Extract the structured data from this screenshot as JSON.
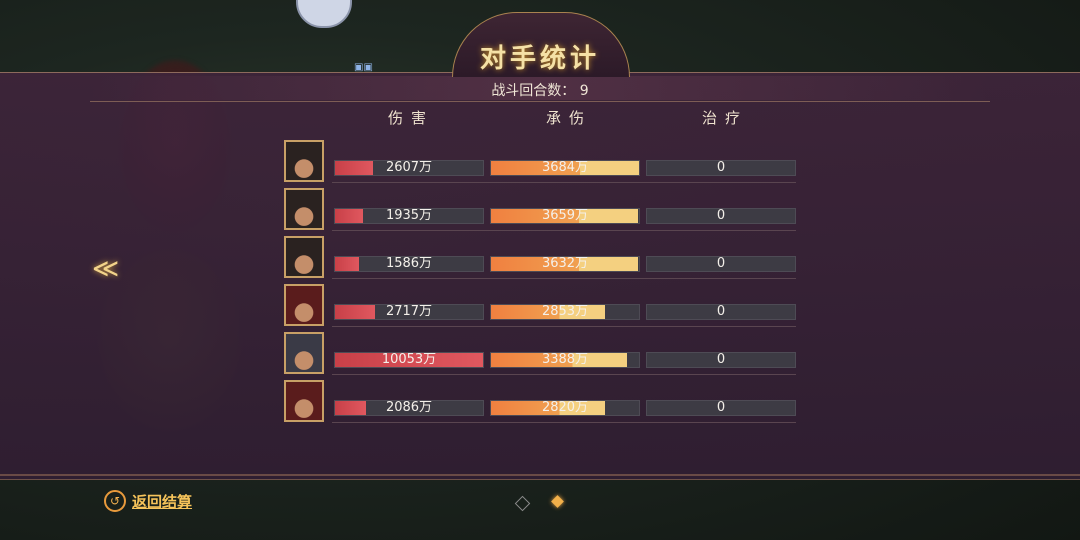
{
  "title": "对手统计",
  "rounds_label": "战斗回合数：",
  "rounds_value": "9",
  "columns": {
    "damage": "伤害",
    "taken": "承伤",
    "heal": "治疗"
  },
  "rows": [
    {
      "damage": "2607万",
      "damage_frac": 0.26,
      "taken": "3684万",
      "taken_frac": 1.0,
      "heal": "0"
    },
    {
      "damage": "1935万",
      "damage_frac": 0.19,
      "taken": "3659万",
      "taken_frac": 0.99,
      "heal": "0"
    },
    {
      "damage": "1586万",
      "damage_frac": 0.16,
      "taken": "3632万",
      "taken_frac": 0.99,
      "heal": "0"
    },
    {
      "damage": "2717万",
      "damage_frac": 0.27,
      "taken": "2853万",
      "taken_frac": 0.77,
      "heal": "0"
    },
    {
      "damage": "10053万",
      "damage_frac": 1.0,
      "taken": "3388万",
      "taken_frac": 0.92,
      "heal": "0"
    },
    {
      "damage": "2086万",
      "damage_frac": 0.21,
      "taken": "2820万",
      "taken_frac": 0.77,
      "heal": "0"
    }
  ],
  "back_label": "返回结算",
  "icons": {
    "back": "return-arrow-icon",
    "prev": "chevron-left-icon"
  },
  "colors": {
    "damage": "#d84a52",
    "taken": "#f0904a",
    "accent": "#f2b04a"
  }
}
